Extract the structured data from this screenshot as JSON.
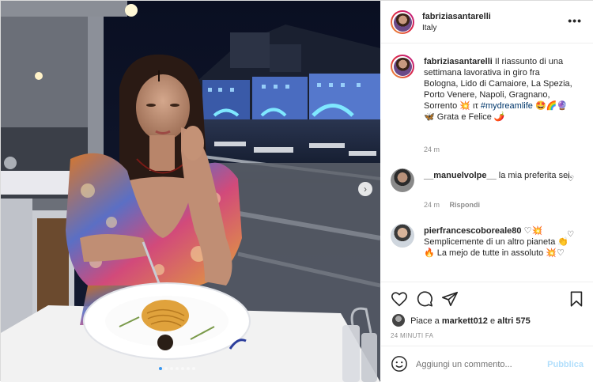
{
  "post": {
    "username": "fabriziasantarelli",
    "location": "Italy",
    "more_label": "•••"
  },
  "caption": {
    "username": "fabriziasantarelli",
    "text": "Il riassunto di una settimana lavorativa in giro fra Bologna, Lido di Camaiore, La Spezia, Porto Venere, Napoli, Gragnano, Sorrento 💥 ιτ",
    "hashtag": "#mydreamlife",
    "emojis": "🤩🌈🔮🦋",
    "tail": "Grata e Felice 🌶️",
    "time": "24 m"
  },
  "comments": [
    {
      "username": "__manuelvolpe__",
      "text": "la mia preferita sei.",
      "time": "24 m",
      "reply_label": "Rispondi"
    },
    {
      "username": "pierfrancescoboreale80",
      "text": "♡💥 Semplicemente di un altro pianeta 👏🔥 La mejo de tutte in assoluto 💥♡"
    }
  ],
  "likes": {
    "prefix": "Piace a",
    "user": "markett012",
    "middle": "e",
    "others": "altri 575"
  },
  "timestamp": "24 MINUTI FA",
  "add_comment": {
    "placeholder": "Aggiungi un commento...",
    "publish_label": "Pubblica"
  },
  "carousel": {
    "slides": 7,
    "active_index": 0
  },
  "colors": {
    "link": "#00376b",
    "publish_disabled": "#b2dffc",
    "carousel_active": "#3897f0"
  },
  "icons": [
    "heart-icon",
    "comment-icon",
    "share-icon",
    "bookmark-icon",
    "emoji-icon",
    "next-arrow-icon",
    "more-options-icon"
  ]
}
